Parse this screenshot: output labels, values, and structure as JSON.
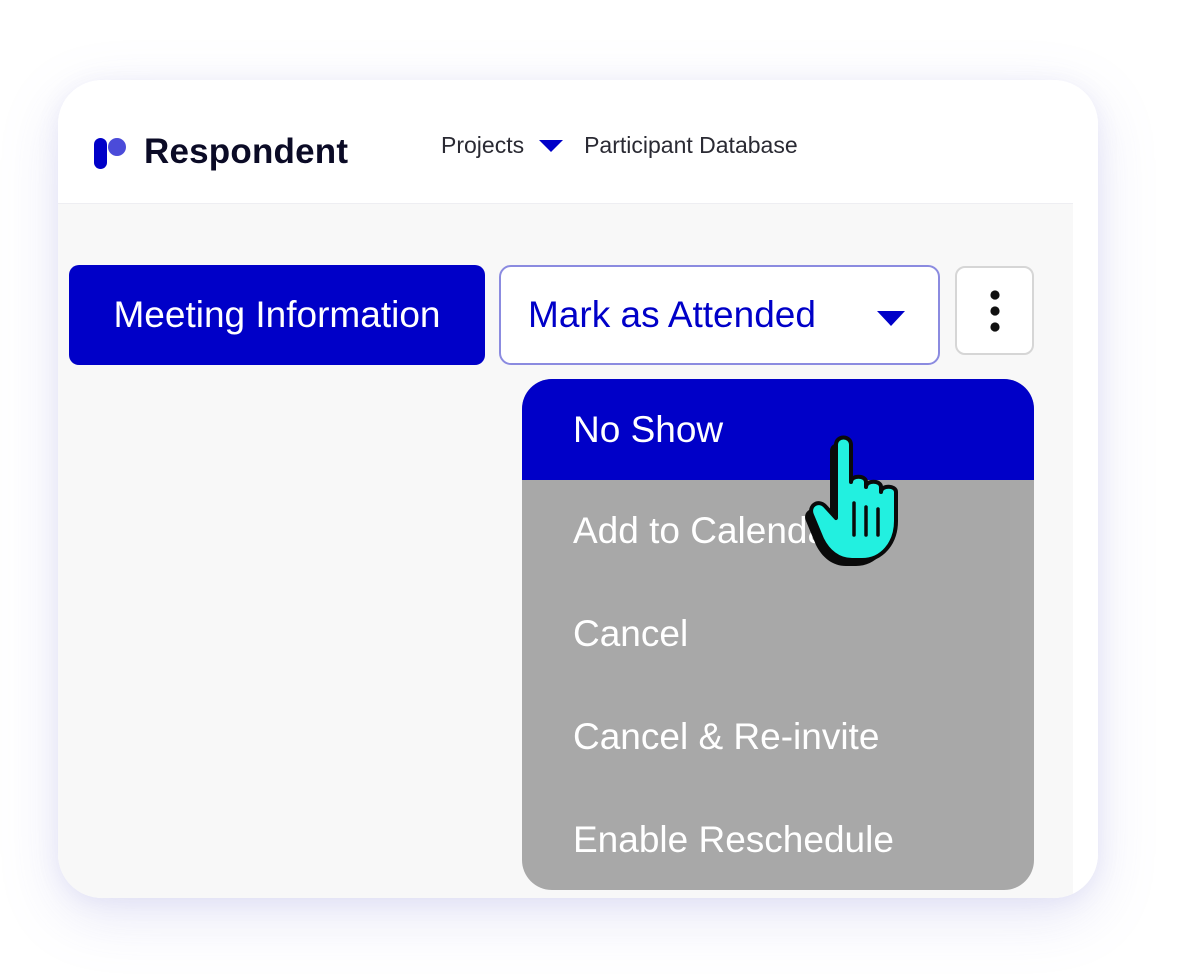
{
  "brand": {
    "name": "Respondent",
    "accent": "#0000c8",
    "logo_accent": "#4b4bd9"
  },
  "nav": {
    "projects": "Projects",
    "participant_database": "Participant Database"
  },
  "toolbar": {
    "meeting_info_label": "Meeting Information",
    "status_label": "Mark as Attended"
  },
  "status_menu": {
    "items": [
      {
        "label": "No Show",
        "active": true
      },
      {
        "label": "Add to Calendar"
      },
      {
        "label": "Cancel"
      },
      {
        "label": "Cancel & Re-invite"
      },
      {
        "label": "Enable Reschedule"
      }
    ]
  },
  "icons": {
    "projects_caret": "chevron-down-icon",
    "status_caret": "chevron-down-icon",
    "more": "more-vertical-icon",
    "cursor": "pointer-hand-icon"
  }
}
